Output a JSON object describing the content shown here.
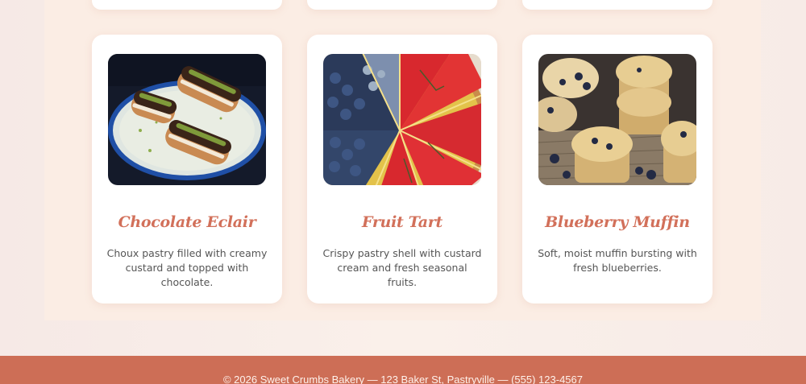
{
  "cards": [
    {
      "title": "Chocolate Eclair",
      "description": "Choux pastry filled with creamy custard and topped with chocolate.",
      "image": "chocolate-eclair-photo"
    },
    {
      "title": "Fruit Tart",
      "description": "Crispy pastry shell with custard cream and fresh seasonal fruits.",
      "image": "fruit-tart-photo"
    },
    {
      "title": "Blueberry Muffin",
      "description": "Soft, moist muffin bursting with fresh blueberries.",
      "image": "blueberry-muffin-photo"
    }
  ],
  "footer": {
    "text": "© 2026 Sweet Crumbs Bakery — 123 Baker St, Pastryville — (555) 123-4567"
  },
  "colors": {
    "accent": "#d2705a",
    "footer_bg": "#cd6e56",
    "panel_bg": "#fbede4",
    "card_bg": "#ffffff"
  }
}
